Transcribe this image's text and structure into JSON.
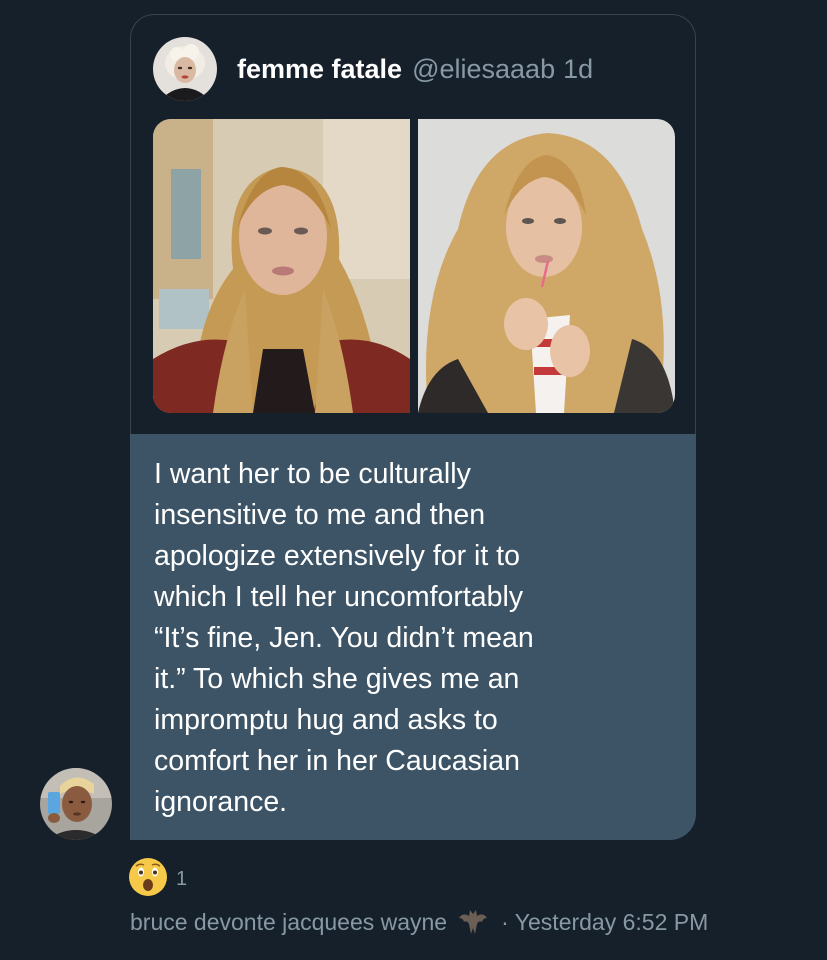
{
  "quoted_tweet": {
    "display_name": "femme fatale",
    "handle": "@eliesaaab",
    "time_ago": "1d",
    "photos": [
      "woman-portrait-icon",
      "woman-drinking-icon"
    ]
  },
  "message": {
    "text": "I want her to be culturally\ninsensitive to me and then\napologize extensively for it to\nwhich I tell her uncomfortably\n“It’s fine, Jen. You didn’t mean\nit.” To which she gives me an\nimpromptu hug and asks to\ncomfort her in her Caucasian\nignorance."
  },
  "reaction": {
    "emoji": "😲",
    "count": "1"
  },
  "meta": {
    "sender_name": "bruce devonte jacquees wayne",
    "separator": "·",
    "timestamp": "Yesterday 6:52 PM",
    "sender_badge_icon": "bat-icon"
  },
  "colors": {
    "background": "#15202b",
    "bubble": "#3d5466",
    "secondary_text": "#8899a6",
    "card_border": "#38444d"
  }
}
